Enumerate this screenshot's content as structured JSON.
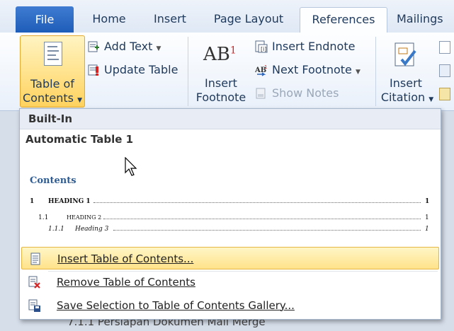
{
  "tabs": {
    "file": "File",
    "home": "Home",
    "insert": "Insert",
    "page_layout": "Page Layout",
    "references": "References",
    "mailings": "Mailings"
  },
  "ribbon": {
    "toc_line1": "Table of",
    "toc_line2": "Contents",
    "add_text": "Add Text",
    "update_table": "Update Table",
    "ab_main": "AB",
    "ab_sup": "1",
    "insert_footnote_1": "Insert",
    "insert_footnote_2": "Footnote",
    "insert_endnote": "Insert Endnote",
    "next_footnote": "Next Footnote",
    "show_notes": "Show Notes",
    "insert_citation_1": "Insert",
    "insert_citation_2": "Citation"
  },
  "dropdown": {
    "section_header": "Built-In",
    "gallery_item_title": "Automatic Table 1",
    "preview": {
      "title": "Contents",
      "lines": [
        {
          "num": "1",
          "text": "HEADING 1",
          "page": "1"
        },
        {
          "num": "1.1",
          "text": "HEADING 2",
          "page": "1"
        },
        {
          "num": "1.1.1",
          "text": "Heading 3",
          "page": "1"
        }
      ]
    },
    "menu": {
      "insert_toc": "Insert Table of Contents...",
      "remove_toc": "Remove Table of Contents",
      "save_selection": "Save Selection to Table of Contents Gallery..."
    }
  },
  "document": {
    "peek_text": "7.1.1  Persiapan Dokumen Mail Merge"
  }
}
